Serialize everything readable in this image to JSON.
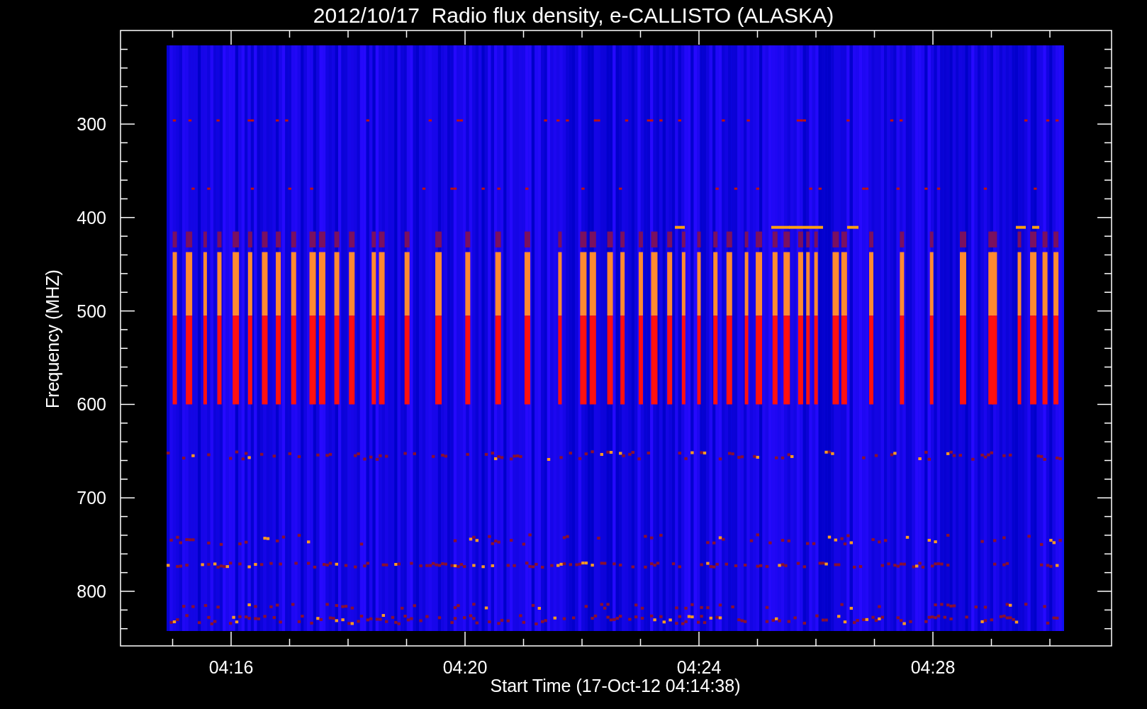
{
  "chart": {
    "title": "2012/10/17  Radio flux density, e-CALLISTO (ALASKA)",
    "ylabel": "Frequency (MHZ)",
    "xlabel": "Start Time (17-Oct-12 04:14:38)",
    "yticks": [
      "300",
      "400",
      "500",
      "600",
      "700",
      "800"
    ],
    "xticks": [
      "04:16",
      "04:20",
      "04:24",
      "04:28"
    ]
  }
}
